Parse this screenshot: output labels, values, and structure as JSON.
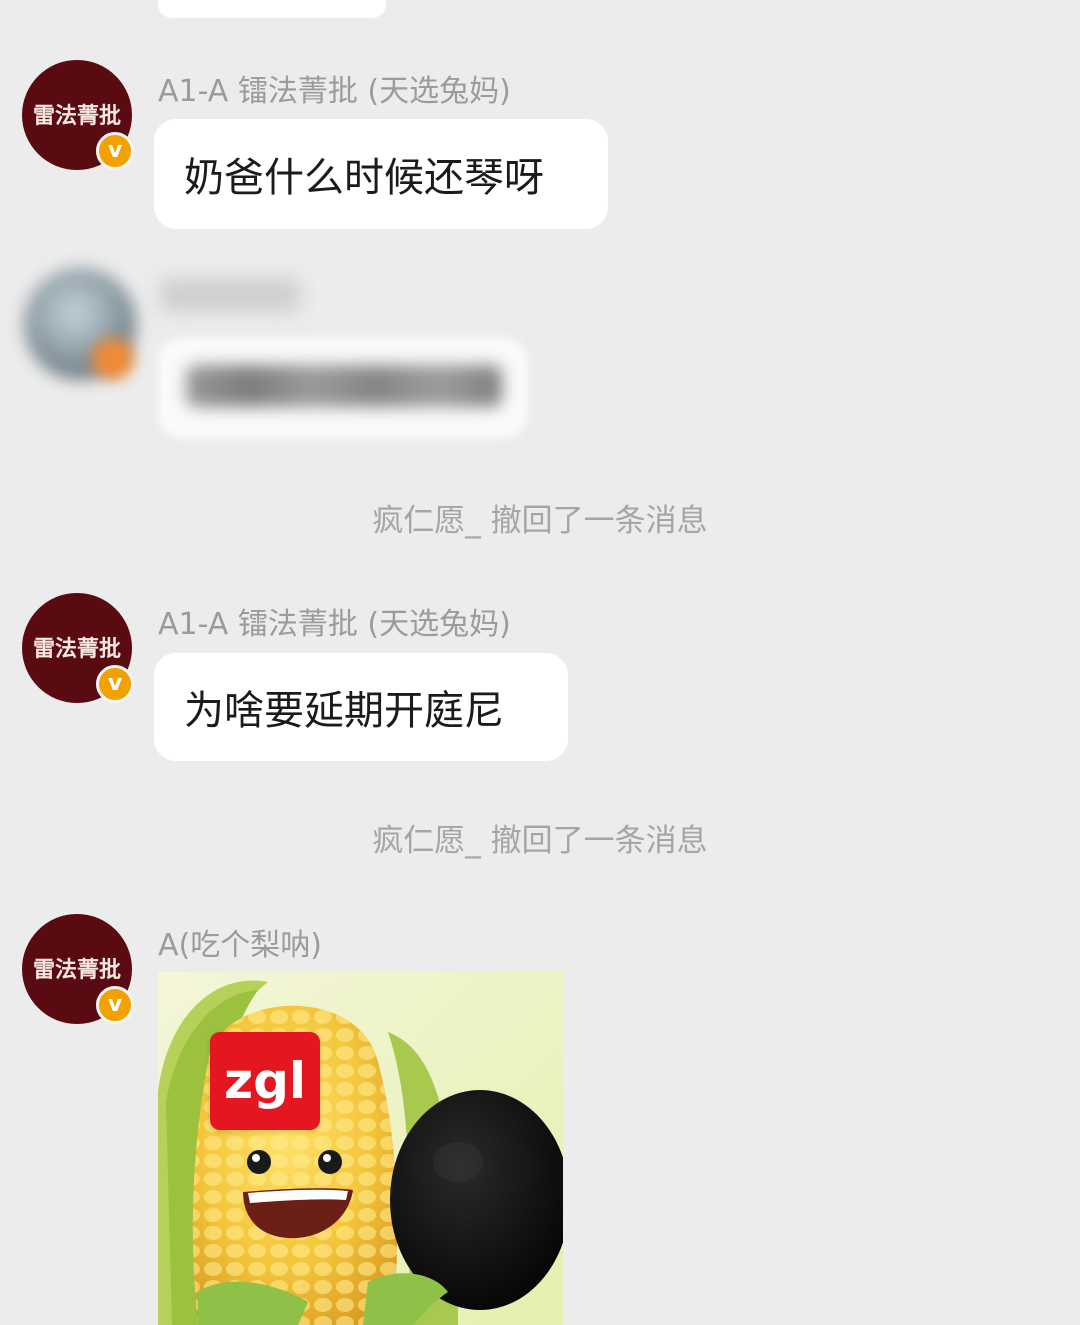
{
  "conversation": [
    {
      "sender": "A1-A 镭法菁批 (天选兔妈)",
      "avatar_text": "雷法菁批",
      "message": "奶爸什么时候还琴呀"
    },
    {
      "sender": "A1-A 镭法菁批 (天选兔妈)",
      "avatar_text": "雷法菁批",
      "message": "为啥要延期开庭尼"
    },
    {
      "sender": "A(吃个梨呐)",
      "avatar_text": "雷法菁批",
      "sticker_text": "zgl"
    }
  ],
  "system_messages": [
    "疯仁愿_ 撤回了一条消息",
    "疯仁愿_ 撤回了一条消息"
  ],
  "badge_symbol": "v",
  "colors": {
    "background": "#ececec",
    "avatar": "#5a0b12",
    "badge": "#f2a100",
    "sticker_label": "#e4161f"
  }
}
